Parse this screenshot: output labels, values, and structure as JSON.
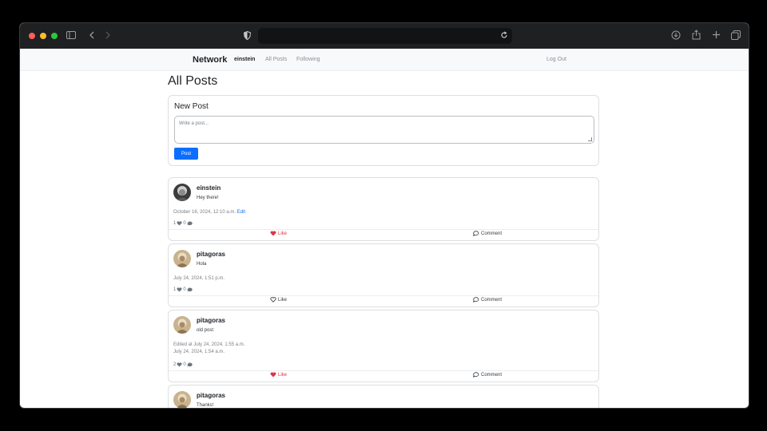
{
  "browser": {
    "icons": [
      "sidebar-icon",
      "back-icon",
      "forward-icon",
      "shield-icon",
      "reload-icon",
      "download-icon",
      "share-icon",
      "new-tab-icon",
      "tabs-overview-icon"
    ]
  },
  "nav": {
    "brand": "Network",
    "user": "einstein",
    "all_posts": "All Posts",
    "following": "Following",
    "logout": "Log Out"
  },
  "page": {
    "title": "All Posts"
  },
  "new_post": {
    "heading": "New Post",
    "placeholder": "Write a post...",
    "button": "Post"
  },
  "posts": [
    {
      "author": "einstein",
      "body": "Hey there!",
      "edited": "",
      "date": "October 16, 2024, 12:10 a.m.",
      "edit_link": "Edit",
      "likes": "1",
      "comments": "0",
      "like_label": "Like",
      "comment_label": "Comment",
      "liked": true
    },
    {
      "author": "pitagoras",
      "body": "Hola",
      "edited": "",
      "date": "July 24, 2024, 1:51 p.m.",
      "edit_link": "",
      "likes": "1",
      "comments": "0",
      "like_label": "Like",
      "comment_label": "Comment",
      "liked": false
    },
    {
      "author": "pitagoras",
      "body": "old post",
      "edited": "Edited at July 24, 2024, 1:55 a.m.",
      "date": "July 24, 2024, 1:54 a.m.",
      "edit_link": "",
      "likes": "2",
      "comments": "0",
      "like_label": "Like",
      "comment_label": "Comment",
      "liked": true
    },
    {
      "author": "pitagoras",
      "body": "Thanks!",
      "edited": "",
      "date": "",
      "edit_link": "",
      "likes": "",
      "comments": "",
      "like_label": "",
      "comment_label": "",
      "liked": false
    }
  ],
  "colors": {
    "accent": "#0d6efd",
    "liked": "#dc3545",
    "chrome": "#1f2022"
  }
}
